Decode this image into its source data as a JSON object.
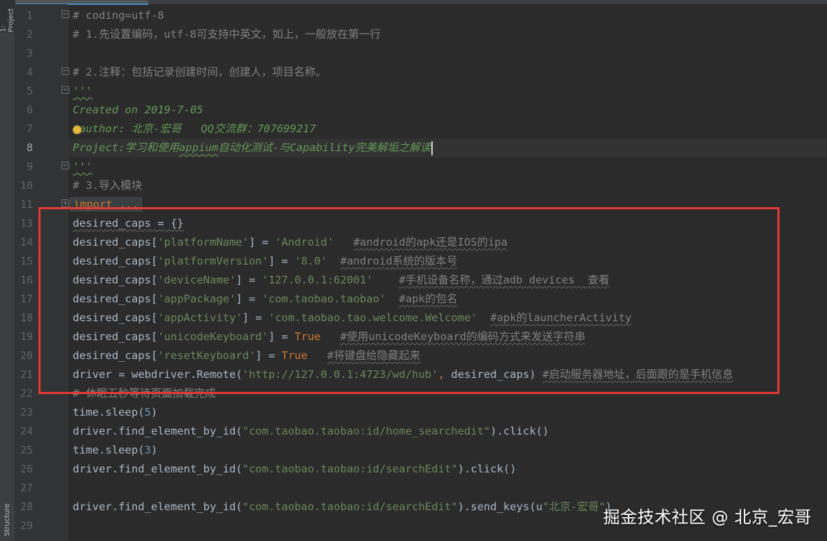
{
  "toolstrip": {
    "project_tab": "1: Project",
    "structure_tab": "Structure"
  },
  "editor": {
    "current_line": "8",
    "lines": [
      {
        "num": "1",
        "tokens": [
          {
            "t": "comment",
            "s": "# coding=utf-8"
          }
        ],
        "fold": "minus"
      },
      {
        "num": "2",
        "tokens": [
          {
            "t": "comment",
            "s": "# 1.先设置编码，utf-8可支持中英文，如上，一般放在第一行"
          }
        ]
      },
      {
        "num": "3",
        "tokens": []
      },
      {
        "num": "4",
        "tokens": [
          {
            "t": "comment",
            "s": "# 2.注释：包括记录创建时间，创建人，项目名称。"
          }
        ],
        "fold": "minus"
      },
      {
        "num": "5",
        "tokens": [
          {
            "t": "doc",
            "s": "'''",
            "squig": true
          }
        ],
        "fold": "minus"
      },
      {
        "num": "6",
        "tokens": [
          {
            "t": "doc",
            "s": "Created on 2019-7-05"
          }
        ]
      },
      {
        "num": "7",
        "tokens": [
          {
            "t": "doc",
            "s": "@author: 北京-宏哥   QQ交流群：707699217"
          }
        ],
        "bulb": true
      },
      {
        "num": "8",
        "tokens": [
          {
            "t": "doc",
            "s": "Project:学习和使用"
          },
          {
            "t": "doc",
            "s": "appium",
            "squig": true
          },
          {
            "t": "doc",
            "s": "自动化测试-与Capability完美解垢之解读"
          }
        ],
        "caret": true
      },
      {
        "num": "9",
        "tokens": [
          {
            "t": "doc",
            "s": "'''",
            "squig": true
          }
        ],
        "fold": "minus"
      },
      {
        "num": "10",
        "tokens": [
          {
            "t": "comment",
            "s": "# 3.导入模块"
          }
        ]
      },
      {
        "num": "11",
        "tokens": [
          {
            "t": "kw",
            "s": "import ...",
            "collapsed": true
          }
        ],
        "fold": "plus"
      },
      {
        "num": "13",
        "tokens": [
          {
            "t": "plain",
            "s": "desired_caps = {}",
            "squig": true
          }
        ]
      },
      {
        "num": "14",
        "tokens": [
          {
            "t": "plain",
            "s": "desired_caps["
          },
          {
            "t": "str",
            "s": "'platformName'"
          },
          {
            "t": "plain",
            "s": "] = "
          },
          {
            "t": "str",
            "s": "'Android'"
          },
          {
            "t": "plain",
            "s": "   "
          },
          {
            "t": "comment",
            "s": "#android的apk还是IOS的ipa",
            "squig": true
          }
        ]
      },
      {
        "num": "15",
        "tokens": [
          {
            "t": "plain",
            "s": "desired_caps["
          },
          {
            "t": "str",
            "s": "'platformVersion'"
          },
          {
            "t": "plain",
            "s": "] = "
          },
          {
            "t": "str",
            "s": "'8.0'"
          },
          {
            "t": "plain",
            "s": "  "
          },
          {
            "t": "comment",
            "s": "#android系统的版本号",
            "squig": true
          }
        ]
      },
      {
        "num": "16",
        "tokens": [
          {
            "t": "plain",
            "s": "desired_caps["
          },
          {
            "t": "str",
            "s": "'deviceName'"
          },
          {
            "t": "plain",
            "s": "] = "
          },
          {
            "t": "str",
            "s": "'127.0.0.1:62001'"
          },
          {
            "t": "plain",
            "s": "    "
          },
          {
            "t": "comment",
            "s": "#手机设备名称，通过adb devices  查看",
            "squig": true
          }
        ]
      },
      {
        "num": "17",
        "tokens": [
          {
            "t": "plain",
            "s": "desired_caps["
          },
          {
            "t": "str",
            "s": "'appPackage'"
          },
          {
            "t": "plain",
            "s": "] = "
          },
          {
            "t": "str",
            "s": "'com.taobao.taobao'"
          },
          {
            "t": "plain",
            "s": "  "
          },
          {
            "t": "comment",
            "s": "#apk的包名",
            "squig": true
          }
        ]
      },
      {
        "num": "18",
        "tokens": [
          {
            "t": "plain",
            "s": "desired_caps["
          },
          {
            "t": "str",
            "s": "'appActivity'"
          },
          {
            "t": "plain",
            "s": "] = "
          },
          {
            "t": "str",
            "s": "'com.taobao.tao.welcome.Welcome'"
          },
          {
            "t": "plain",
            "s": "  "
          },
          {
            "t": "comment",
            "s": "#apk的launcherActivity",
            "squig": true
          }
        ]
      },
      {
        "num": "19",
        "tokens": [
          {
            "t": "plain",
            "s": "desired_caps["
          },
          {
            "t": "str",
            "s": "'unicodeKeyboard'"
          },
          {
            "t": "plain",
            "s": "] = "
          },
          {
            "t": "kw",
            "s": "True"
          },
          {
            "t": "plain",
            "s": "   "
          },
          {
            "t": "comment",
            "s": "#使用unicodeKeyboard的编码方式来发送字符串",
            "squig": true
          }
        ]
      },
      {
        "num": "20",
        "tokens": [
          {
            "t": "plain",
            "s": "desired_caps["
          },
          {
            "t": "str",
            "s": "'resetKeyboard'"
          },
          {
            "t": "plain",
            "s": "] = "
          },
          {
            "t": "kw",
            "s": "True"
          },
          {
            "t": "plain",
            "s": "   "
          },
          {
            "t": "comment",
            "s": "#将键盘给隐藏起来",
            "squig": true
          }
        ]
      },
      {
        "num": "21",
        "tokens": [
          {
            "t": "plain",
            "s": "driver = webdriver.Remote("
          },
          {
            "t": "str",
            "s": "'http://127.0.0.1:4723/wd/hub'"
          },
          {
            "t": "kw",
            "s": ","
          },
          {
            "t": "plain",
            "s": " desired_caps) "
          },
          {
            "t": "comment",
            "s": "#启动服务器地址，后面跟的是手机信息",
            "squig": true
          }
        ]
      },
      {
        "num": "22",
        "tokens": [
          {
            "t": "comment",
            "s": "# 休眠五秒等待页面加载完成"
          }
        ]
      },
      {
        "num": "23",
        "tokens": [
          {
            "t": "plain",
            "s": "time.sleep("
          },
          {
            "t": "num",
            "s": "5"
          },
          {
            "t": "plain",
            "s": ")"
          }
        ]
      },
      {
        "num": "24",
        "tokens": [
          {
            "t": "plain",
            "s": "driver.find_element_by_id("
          },
          {
            "t": "str",
            "s": "\"com.taobao.taobao:id/home_searchedit\""
          },
          {
            "t": "plain",
            "s": ").click()"
          }
        ]
      },
      {
        "num": "25",
        "tokens": [
          {
            "t": "plain",
            "s": "time.sleep("
          },
          {
            "t": "num",
            "s": "3"
          },
          {
            "t": "plain",
            "s": ")"
          }
        ]
      },
      {
        "num": "26",
        "tokens": [
          {
            "t": "plain",
            "s": "driver.find_element_by_id("
          },
          {
            "t": "str",
            "s": "\"com.taobao.taobao:id/searchEdit\""
          },
          {
            "t": "plain",
            "s": ").click()"
          }
        ]
      },
      {
        "num": "27",
        "tokens": []
      },
      {
        "num": "28",
        "tokens": [
          {
            "t": "plain",
            "s": "driver.find_element_by_id("
          },
          {
            "t": "str",
            "s": "\"com.taobao.taobao:id/searchEdit\""
          },
          {
            "t": "plain",
            "s": ").send_keys(u"
          },
          {
            "t": "str",
            "s": "\"北京-宏哥\""
          },
          {
            "t": "plain",
            "s": ")"
          }
        ]
      },
      {
        "num": "29",
        "tokens": []
      }
    ]
  },
  "colors": {
    "background": "#2b2b2b",
    "highlight_box": "#e53935",
    "comment": "#808080",
    "docstring": "#629755",
    "string": "#6a8759",
    "keyword": "#cc7832"
  },
  "watermark": "掘金技术社区 @ 北京_宏哥"
}
